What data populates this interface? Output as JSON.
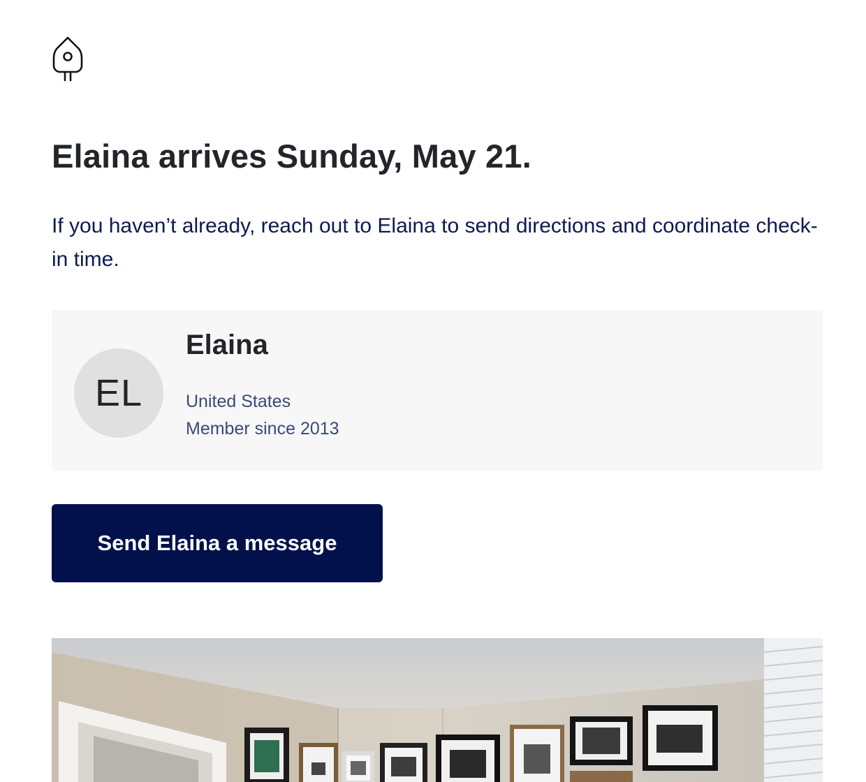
{
  "header": {
    "logo_icon": "birdhouse-icon"
  },
  "main": {
    "headline": "Elaina arrives Sunday, May 21.",
    "intro": "If you haven’t already, reach out to Elaina to send directions and coordinate check-in time."
  },
  "guest": {
    "initials": "EL",
    "name": "Elaina",
    "country": "United States",
    "member_since": "Member since 2013"
  },
  "cta": {
    "label": "Send Elaina a message"
  },
  "photo": {
    "alt": "Room with framed photographs on the wall"
  },
  "colors": {
    "navy": "#02114b",
    "card_bg": "#f7f7f7",
    "avatar_bg": "#e0e0e0",
    "text_dark": "#222529",
    "text_navy": "#0d1a52"
  }
}
